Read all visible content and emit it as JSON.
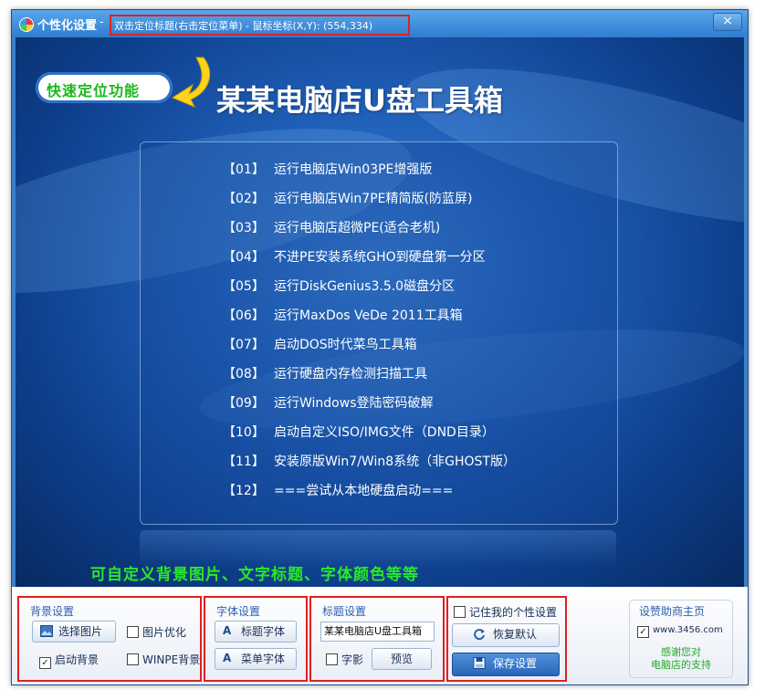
{
  "window": {
    "title": "个性化设置",
    "title_separator": "-",
    "hint": "双击定位标题(右击定位菜单) - 鼠标坐标(X,Y): (554,334)",
    "close_label": "×"
  },
  "banner": {
    "quick_locate": "快速定位功能",
    "main_title": "某某电脑店U盘工具箱"
  },
  "menu": {
    "items": [
      {
        "num": "【01】",
        "label": "运行电脑店Win03PE增强版"
      },
      {
        "num": "【02】",
        "label": "运行电脑店Win7PE精简版(防蓝屏)"
      },
      {
        "num": "【03】",
        "label": "运行电脑店超微PE(适合老机)"
      },
      {
        "num": "【04】",
        "label": "不进PE安装系统GHO到硬盘第一分区"
      },
      {
        "num": "【05】",
        "label": "运行DiskGenius3.5.0磁盘分区"
      },
      {
        "num": "【06】",
        "label": "运行MaxDos VeDe 2011工具箱"
      },
      {
        "num": "【07】",
        "label": "启动DOS时代菜鸟工具箱"
      },
      {
        "num": "【08】",
        "label": "运行硬盘内存检测扫描工具"
      },
      {
        "num": "【09】",
        "label": "运行Windows登陆密码破解"
      },
      {
        "num": "【10】",
        "label": "启动自定义ISO/IMG文件（DND目录）"
      },
      {
        "num": "【11】",
        "label": "安装原版Win7/Win8系统（非GHOST版）"
      },
      {
        "num": "【12】",
        "label": "===尝试从本地硬盘启动==="
      }
    ]
  },
  "footer_note": "可自定义背景图片、文字标题、字体颜色等等",
  "background_settings": {
    "label": "背景设置",
    "select_image": "选择图片",
    "image_optimize": {
      "label": "图片优化",
      "checked": false
    },
    "enable_background": {
      "label": "启动背景",
      "checked": true
    },
    "winpe_background": {
      "label": "WINPE背景",
      "checked": false
    }
  },
  "font_settings": {
    "label": "字体设置",
    "title_font": "标题字体",
    "menu_font": "菜单字体"
  },
  "title_settings": {
    "label": "标题设置",
    "title_value": "某某电脑店U盘工具箱",
    "shadow": {
      "label": "字影",
      "checked": false
    },
    "preview": "预览"
  },
  "actions": {
    "remember": {
      "label": "记住我的个性设置",
      "checked": false
    },
    "restore_default": "恢复默认",
    "save_settings": "保存设置"
  },
  "sponsor": {
    "label": "设赞助商主页",
    "site": {
      "label": "www.3456.com",
      "checked": true
    },
    "thanks_line1": "感谢您对",
    "thanks_line2": "电脑店的支持"
  },
  "colors": {
    "accent": "#2f7dcf",
    "highlight_border": "#e02020",
    "green_text": "#29e829",
    "save_button": "#2f6fc4"
  }
}
